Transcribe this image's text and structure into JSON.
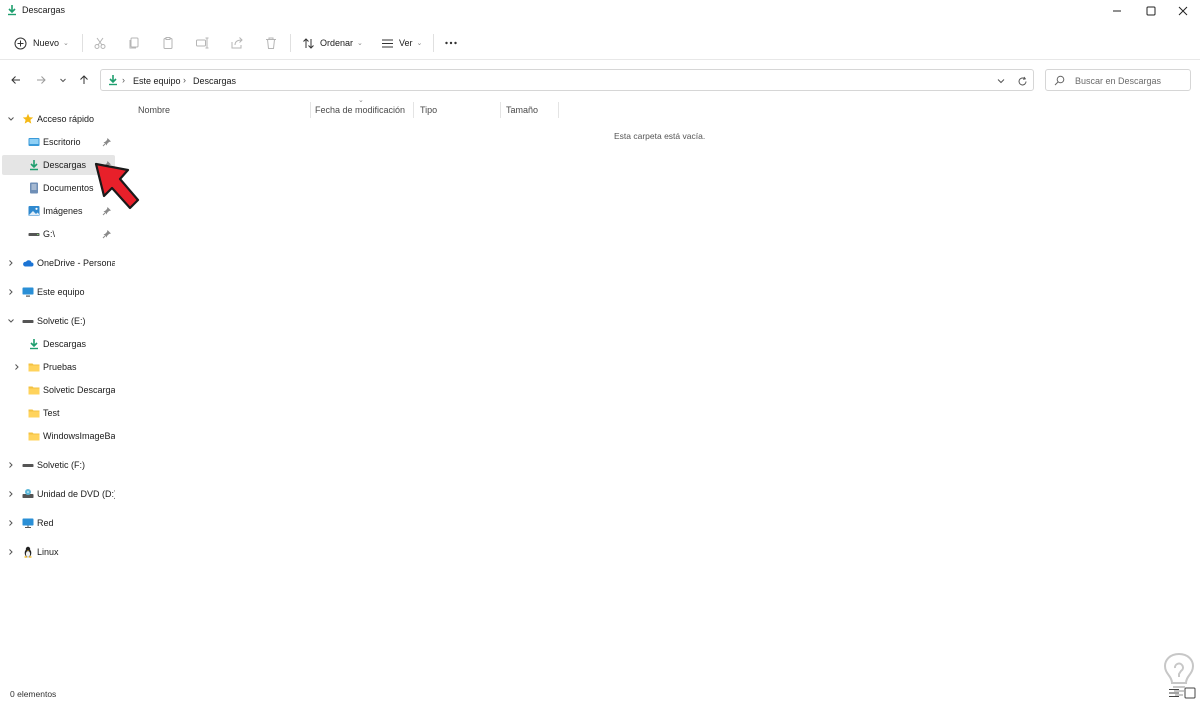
{
  "window": {
    "title": "Descargas",
    "controls": {
      "minimize": "minimize-icon",
      "maximize": "maximize-icon",
      "close": "close-icon"
    }
  },
  "toolbar": {
    "new_label": "Nuevo",
    "sort_label": "Ordenar",
    "view_label": "Ver",
    "icons": [
      "cut-icon",
      "copy-icon",
      "paste-icon",
      "rename-icon",
      "share-icon",
      "delete-icon",
      "more-icon"
    ]
  },
  "address": {
    "crumbs": [
      "Este equipo",
      "Descargas"
    ]
  },
  "search": {
    "placeholder": "Buscar en Descargas"
  },
  "sidebar": {
    "items": [
      {
        "label": "Acceso rápido",
        "icon": "star-icon"
      },
      {
        "label": "Escritorio",
        "icon": "desktop-icon",
        "pinned": true
      },
      {
        "label": "Descargas",
        "icon": "download-icon",
        "pinned": true,
        "selected": true
      },
      {
        "label": "Documentos",
        "icon": "documents-icon"
      },
      {
        "label": "Imágenes",
        "icon": "pictures-icon",
        "pinned": true
      },
      {
        "label": "G:\\",
        "icon": "drive-icon",
        "pinned": true
      },
      {
        "label": "OneDrive - Personal",
        "icon": "cloud-icon"
      },
      {
        "label": "Este equipo",
        "icon": "computer-icon"
      },
      {
        "label": "Solvetic (E:)",
        "icon": "drive-icon"
      },
      {
        "label": "Descargas",
        "icon": "download-icon"
      },
      {
        "label": "Pruebas",
        "icon": "folder-icon"
      },
      {
        "label": "Solvetic Descargas",
        "icon": "folder-icon"
      },
      {
        "label": "Test",
        "icon": "folder-icon"
      },
      {
        "label": "WindowsImageBackup",
        "icon": "folder-icon"
      },
      {
        "label": "Solvetic (F:)",
        "icon": "drive-icon"
      },
      {
        "label": "Unidad de DVD (D:)",
        "icon": "dvd-icon"
      },
      {
        "label": "Red",
        "icon": "network-icon"
      },
      {
        "label": "Linux",
        "icon": "linux-icon"
      }
    ]
  },
  "columns": [
    "Nombre",
    "Fecha de modificación",
    "Tipo",
    "Tamaño"
  ],
  "empty_message": "Esta carpeta está vacía.",
  "status": {
    "count": "0 elementos"
  },
  "colors": {
    "accent_download": "#1e9e6e",
    "folder": "#f3c242",
    "selection": "#e5e5e5",
    "annotation_arrow": "#e8202a"
  }
}
